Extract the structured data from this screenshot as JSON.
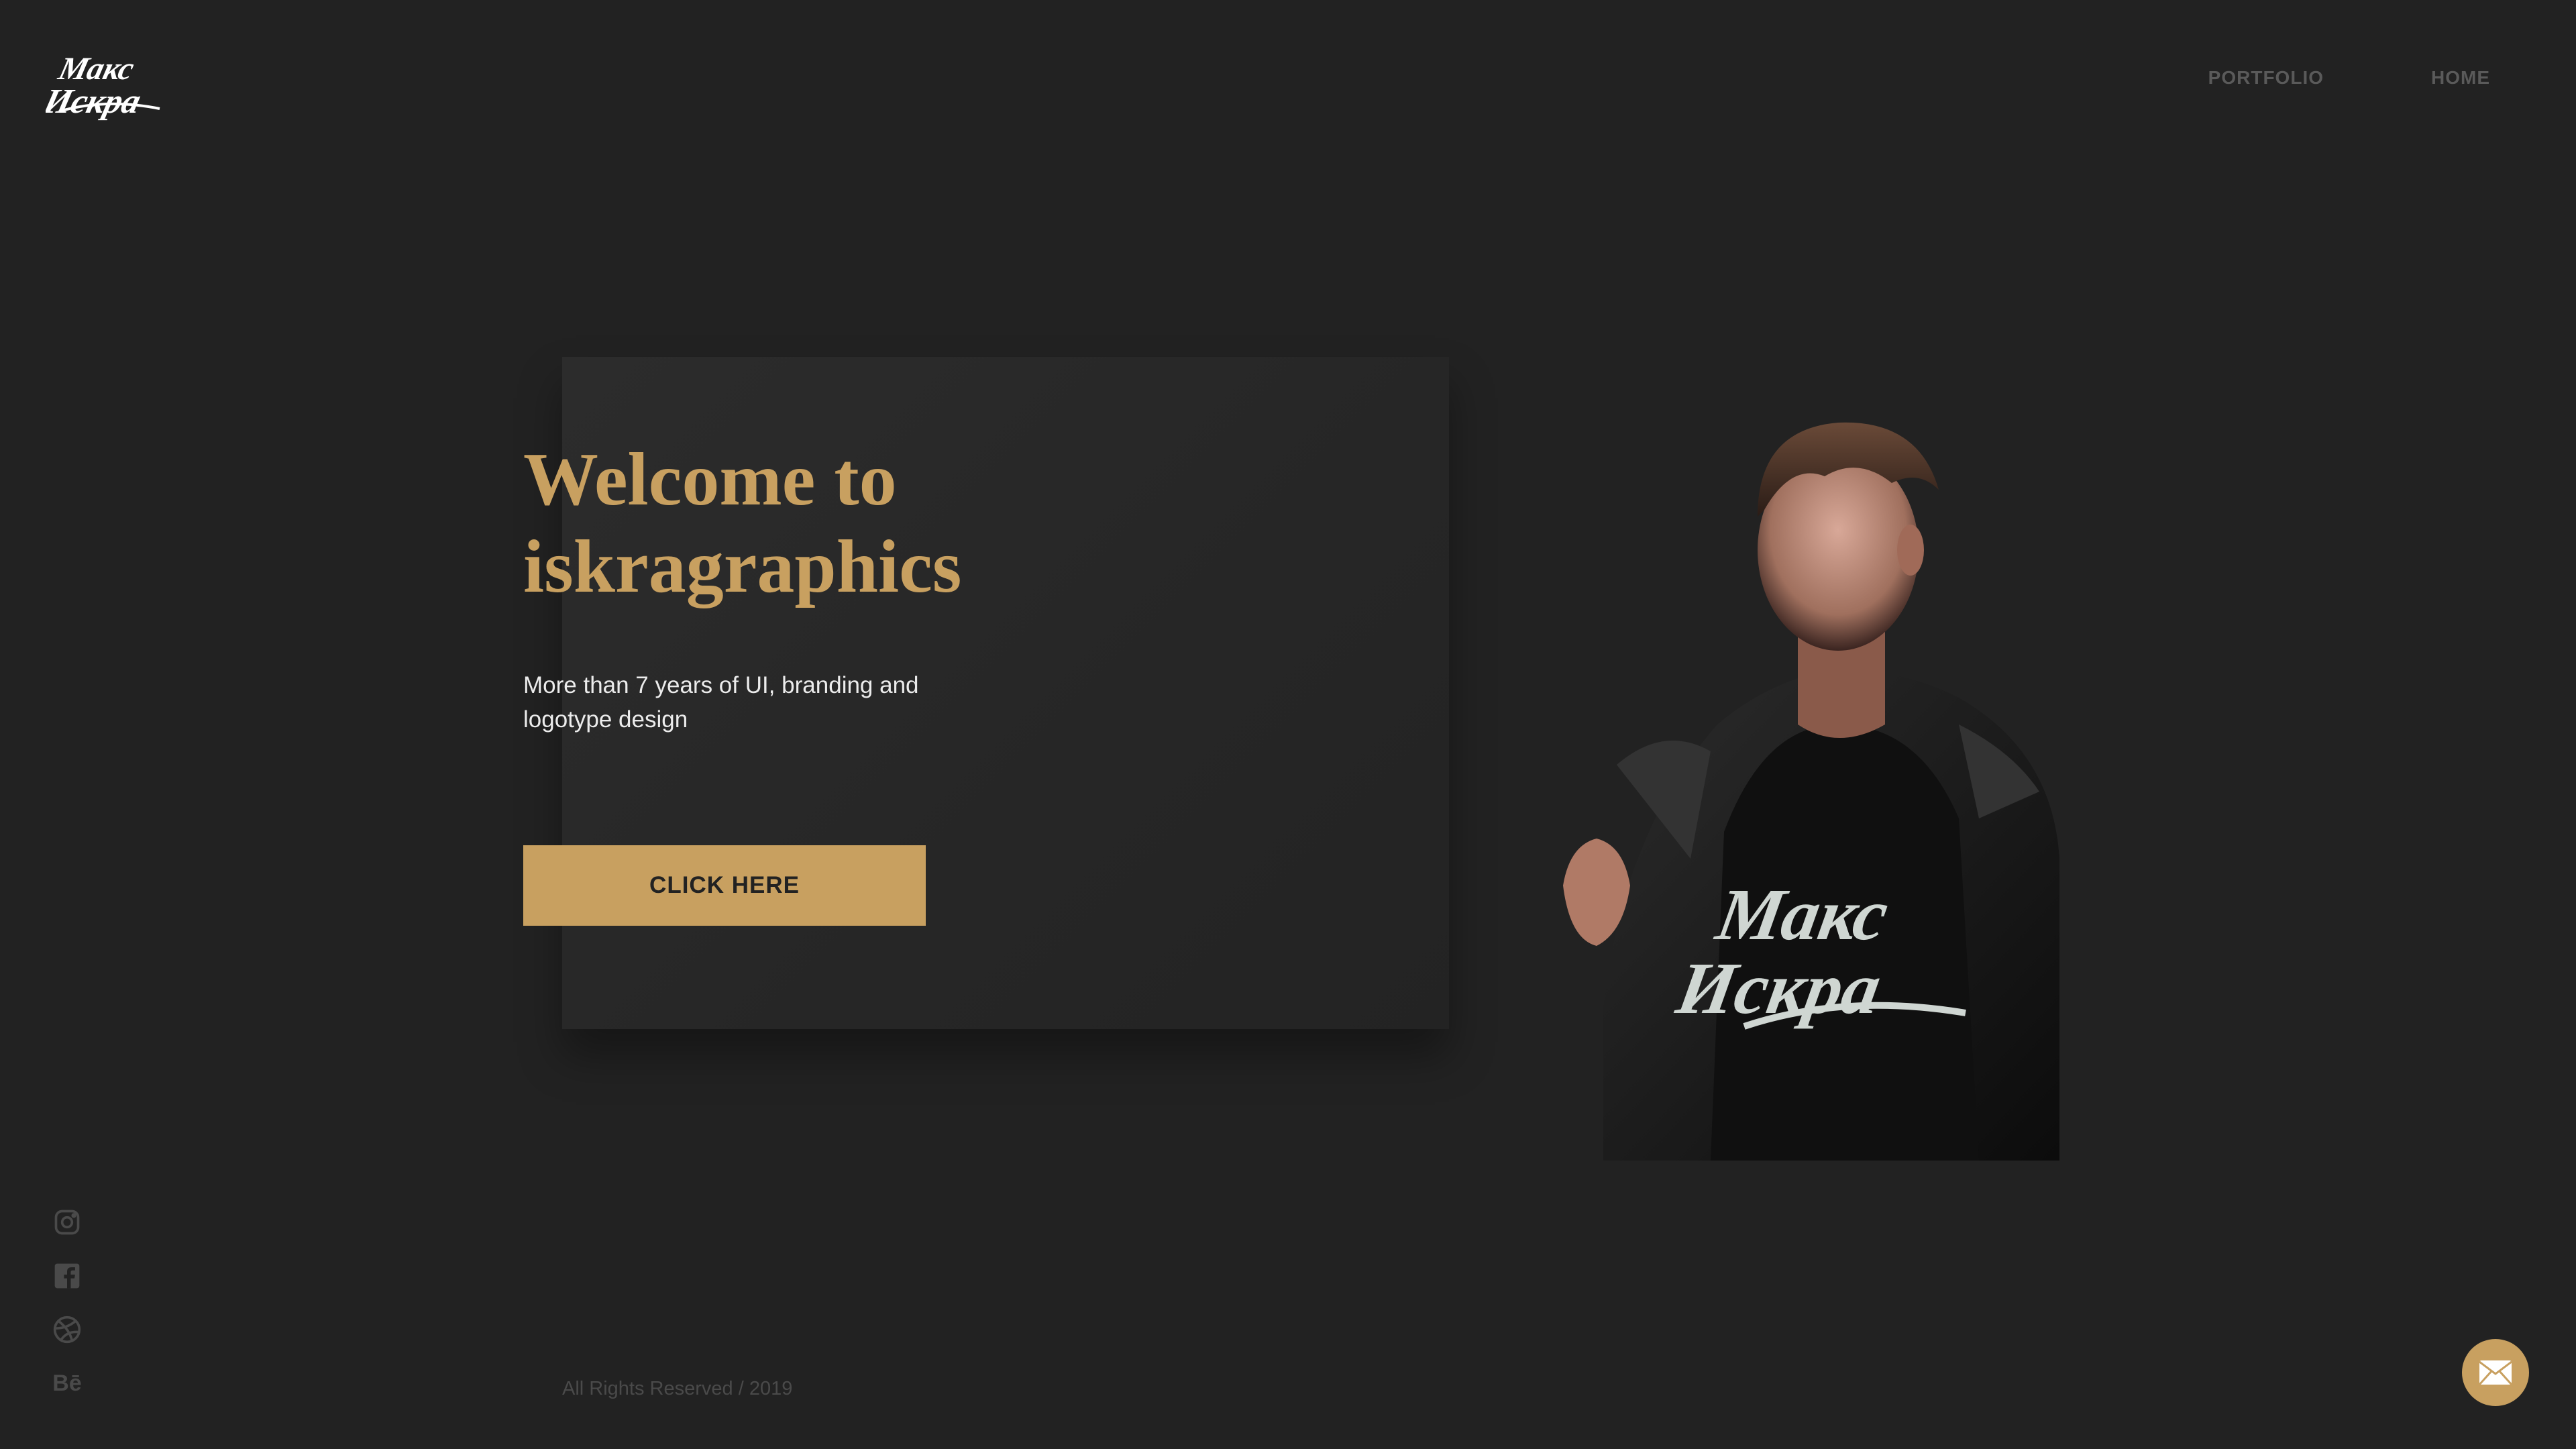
{
  "logo": {
    "alt": "Макс Искра",
    "line1": "Макс",
    "line2": "Искра"
  },
  "nav": {
    "items": [
      {
        "label": "PORTFOLIO"
      },
      {
        "label": "HOME"
      }
    ]
  },
  "hero": {
    "title_line1": "Welcome to",
    "title_line2": "iskragraphics",
    "subtitle": "More than 7 years of UI, branding and logotype design",
    "cta_label": "CLICK HERE"
  },
  "portrait": {
    "shirt_text_line1": "Макс",
    "shirt_text_line2": "Искра"
  },
  "social": {
    "icons": [
      "instagram-icon",
      "facebook-icon",
      "dribbble-icon",
      "behance-icon"
    ],
    "behance_label": "Bē"
  },
  "footer": {
    "copyright": "All Rights Reserved / 2019"
  },
  "colors": {
    "background": "#222222",
    "accent": "#c8a060",
    "muted": "#4a4a4a"
  }
}
